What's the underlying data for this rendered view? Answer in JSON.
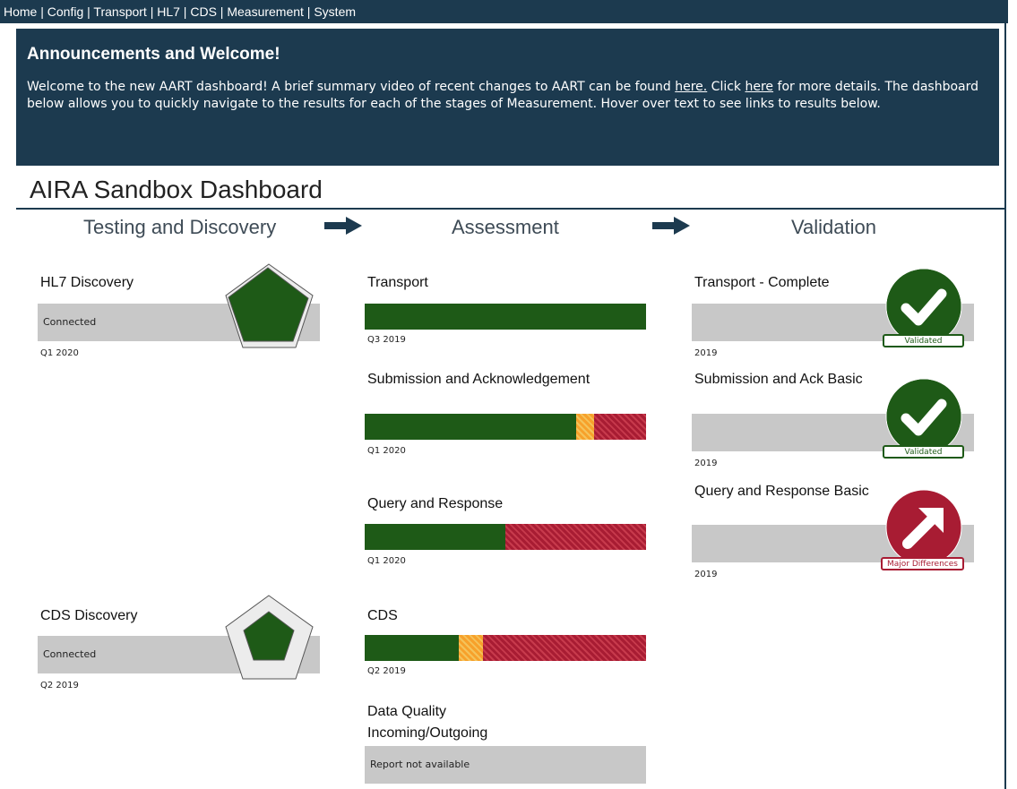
{
  "nav": {
    "items": [
      "Home",
      "Config",
      "Transport",
      "HL7",
      "CDS",
      "Measurement",
      "System"
    ],
    "separator": " | "
  },
  "announcement": {
    "title": "Announcements and Welcome!",
    "text_1": "Welcome to the new AART dashboard! A brief summary video of recent changes to AART can be found ",
    "link_1": "here.",
    "text_2": " Click ",
    "link_2": "here",
    "text_3": " for more details. The dashboard below allows you to quickly navigate to the results for each of the stages of Measurement. Hover over text to see links to results below."
  },
  "dashboard": {
    "title": "AIRA Sandbox Dashboard",
    "stages": [
      "Testing and Discovery",
      "Assessment",
      "Validation"
    ]
  },
  "discovery": [
    {
      "label": "HL7 Discovery",
      "status": "Connected",
      "date": "Q1 2020"
    },
    {
      "label": "CDS Discovery",
      "status": "Connected",
      "date": "Q2 2019"
    }
  ],
  "assessment": [
    {
      "label": "Transport",
      "date": "Q3 2019",
      "segments": [
        {
          "type": "green",
          "fraction": 1.0
        }
      ]
    },
    {
      "label": "Submission and Acknowledgement",
      "date": "Q1 2020",
      "segments": [
        {
          "type": "green",
          "fraction": 0.75
        },
        {
          "type": "orange",
          "fraction": 0.065
        },
        {
          "type": "red",
          "fraction": 0.185
        }
      ]
    },
    {
      "label": "Query and Response",
      "date": "Q1 2020",
      "segments": [
        {
          "type": "green",
          "fraction": 0.5
        },
        {
          "type": "red",
          "fraction": 0.5
        }
      ]
    },
    {
      "label": "CDS",
      "date": "Q2 2019",
      "segments": [
        {
          "type": "green",
          "fraction": 0.335
        },
        {
          "type": "orange",
          "fraction": 0.085
        },
        {
          "type": "red",
          "fraction": 0.58
        }
      ]
    },
    {
      "label": "Data Quality Incoming/Outgoing",
      "status": "Report not available"
    }
  ],
  "validation": [
    {
      "label": "Transport - Complete",
      "date": "2019",
      "badge": "Validated",
      "icon": "check-icon"
    },
    {
      "label": "Submission and Ack Basic",
      "date": "2019",
      "badge": "Validated",
      "icon": "check-icon"
    },
    {
      "label": "Query and Response Basic",
      "date": "2019",
      "badge": "Major Differences",
      "icon": "arrow-up-right-icon"
    }
  ],
  "colors": {
    "navy": "#1c3a4f",
    "green": "#1e5a17",
    "orange": "#f7a12b",
    "red": "#a81c33",
    "grey": "#c8c8c8"
  }
}
